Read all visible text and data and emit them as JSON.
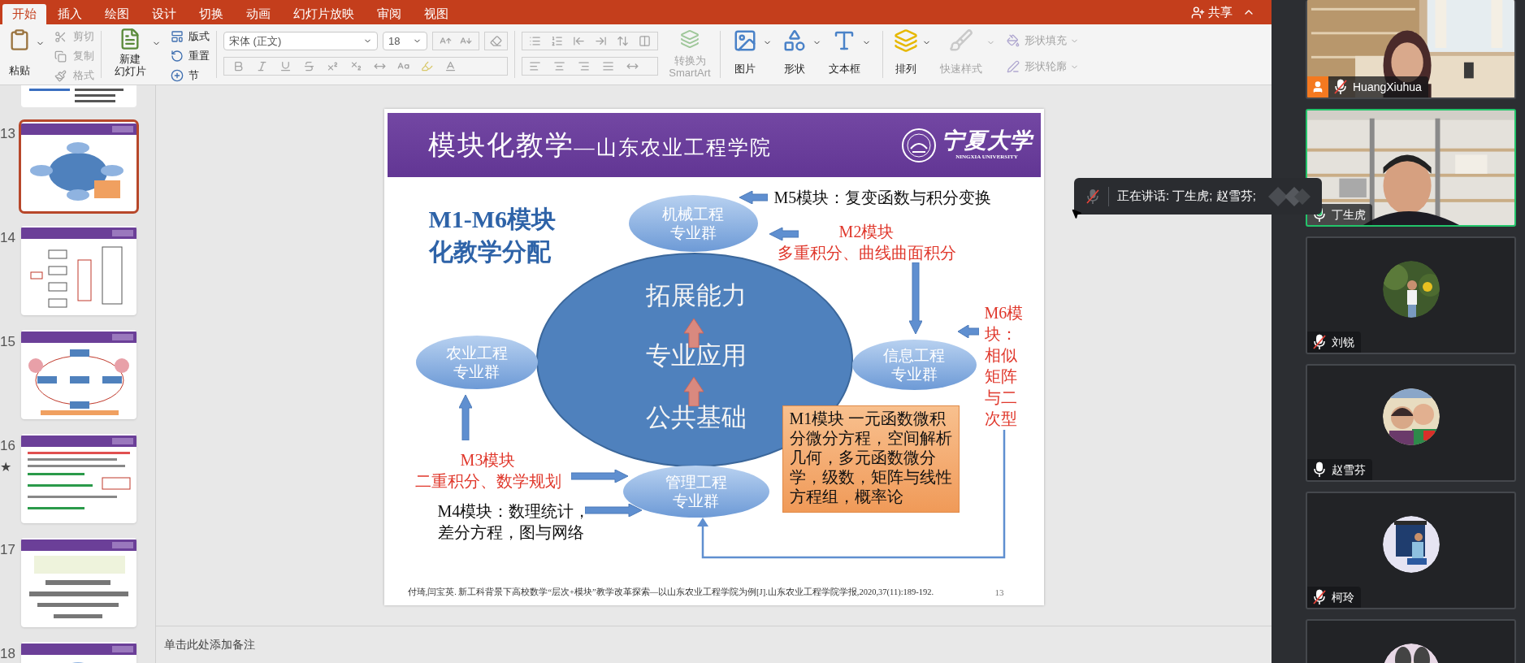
{
  "ribbon_tabs": [
    {
      "label": "开始",
      "selected": true
    },
    {
      "label": "插入",
      "selected": false
    },
    {
      "label": "绘图",
      "selected": false
    },
    {
      "label": "设计",
      "selected": false
    },
    {
      "label": "切换",
      "selected": false
    },
    {
      "label": "动画",
      "selected": false
    },
    {
      "label": "幻灯片放映",
      "selected": false
    },
    {
      "label": "审阅",
      "selected": false
    },
    {
      "label": "视图",
      "selected": false
    }
  ],
  "share": {
    "label": "共享"
  },
  "ribbon": {
    "paste": {
      "label": "粘贴",
      "disabled": false
    },
    "clipboard": [
      {
        "kind": "cut",
        "label": "剪切",
        "disabled": true
      },
      {
        "kind": "copy",
        "label": "复制",
        "disabled": true
      },
      {
        "kind": "format",
        "label": "格式",
        "disabled": true
      }
    ],
    "new_slide": {
      "lines": [
        "新建",
        "幻灯片"
      ],
      "disabled": false
    },
    "slide_tools": [
      {
        "kind": "layout",
        "label": "版式",
        "disabled": false
      },
      {
        "kind": "reset",
        "label": "重置",
        "disabled": false
      },
      {
        "kind": "section",
        "label": "节",
        "disabled": false
      }
    ],
    "font": {
      "value": "宋体 (正文)",
      "size": "18"
    },
    "font_format": {
      "disabled": true
    },
    "paragraph": {
      "disabled": true
    },
    "convert_smartart": {
      "lines": [
        "转换为",
        "SmartArt"
      ],
      "disabled": true
    },
    "insert": [
      {
        "kind": "picture",
        "label": "图片",
        "disabled": false
      },
      {
        "kind": "shape",
        "label": "形状",
        "disabled": false
      },
      {
        "kind": "textbox",
        "label": "文本框",
        "disabled": false
      }
    ],
    "arrange": {
      "label": "排列",
      "disabled": false
    },
    "quick_styles": {
      "label": "快速样式",
      "disabled": true
    },
    "shape_format": [
      {
        "kind": "fill",
        "label": "形状填充",
        "disabled": true
      },
      {
        "kind": "outline",
        "label": "形状轮廓",
        "disabled": true
      }
    ]
  },
  "thumbnails": [
    {
      "kind": "partial"
    },
    {
      "kind": "slide",
      "number": "13",
      "selected": true
    },
    {
      "kind": "slide",
      "number": "14",
      "selected": false
    },
    {
      "kind": "slide",
      "number": "15",
      "selected": false
    },
    {
      "kind": "slide",
      "number": "16",
      "selected": false,
      "mark": "★"
    },
    {
      "kind": "slide",
      "number": "17",
      "selected": false
    },
    {
      "kind": "slide",
      "number": "18",
      "selected": false
    }
  ],
  "slide": {
    "title": "模块化教学",
    "title_suffix": "—山东农业工程学院",
    "logo": {
      "name": "宁夏大学",
      "english": "NINGXIA UNIVERSITY"
    },
    "heading": [
      "M1-M6模块",
      "化教学分配"
    ],
    "core": [
      "拓展能力",
      "专业应用",
      "公共基础"
    ],
    "groups": [
      {
        "lines": [
          "机械工程",
          "专业群"
        ]
      },
      {
        "lines": [
          "农业工程",
          "专业群"
        ]
      },
      {
        "lines": [
          "信息工程",
          "专业群"
        ]
      },
      {
        "lines": [
          "管理工程",
          "专业群"
        ]
      }
    ],
    "modules": [
      {
        "color": "#111111",
        "lines": [
          "M5模块：复变函数与积分变换"
        ]
      },
      {
        "color": "#e0382c",
        "lines": [
          "M2模块",
          "多重积分、曲线曲面积分"
        ]
      },
      {
        "color": "#e0382c",
        "lines": [
          "M6模块：相似矩阵与二次型"
        ]
      },
      {
        "color": "#e0382c",
        "lines": [
          "M3模块",
          "二重积分、数学规划"
        ]
      },
      {
        "color": "#111111",
        "lines": [
          "M4模块：数理统计，",
          "差分方程，图与网络"
        ]
      }
    ],
    "m1_box": "M1模块 一元函数微积分微分方程，空间解析几何，多元函数微分学，级数，矩阵与线性方程组，概率论",
    "citation": "付琦,闫宝英. 新工科背景下高校数学“层次+模块”教学改革探索—以山东农业工程学院为例[J].山东农业工程学院学报,2020,37(11):189-192.",
    "page_number": "13"
  },
  "notes_prompt": "单击此处添加备注",
  "speaking_toast": {
    "text": "正在讲话: 丁生虎; 赵雪芬;"
  },
  "participants": [
    {
      "kind": "video",
      "name": "HuangXiuhua",
      "host": true,
      "muted": true,
      "speaking": false
    },
    {
      "kind": "video",
      "name": "丁生虎",
      "host": false,
      "muted": false,
      "speaking": true
    },
    {
      "kind": "avatar",
      "name": "刘锐",
      "host": false,
      "muted": true,
      "speaking": false
    },
    {
      "kind": "avatar",
      "name": "赵雪芬",
      "host": false,
      "muted": false,
      "speaking": false
    },
    {
      "kind": "avatar",
      "name": "柯玲",
      "host": false,
      "muted": true,
      "speaking": false
    },
    {
      "kind": "avatar",
      "speaking": false
    }
  ]
}
